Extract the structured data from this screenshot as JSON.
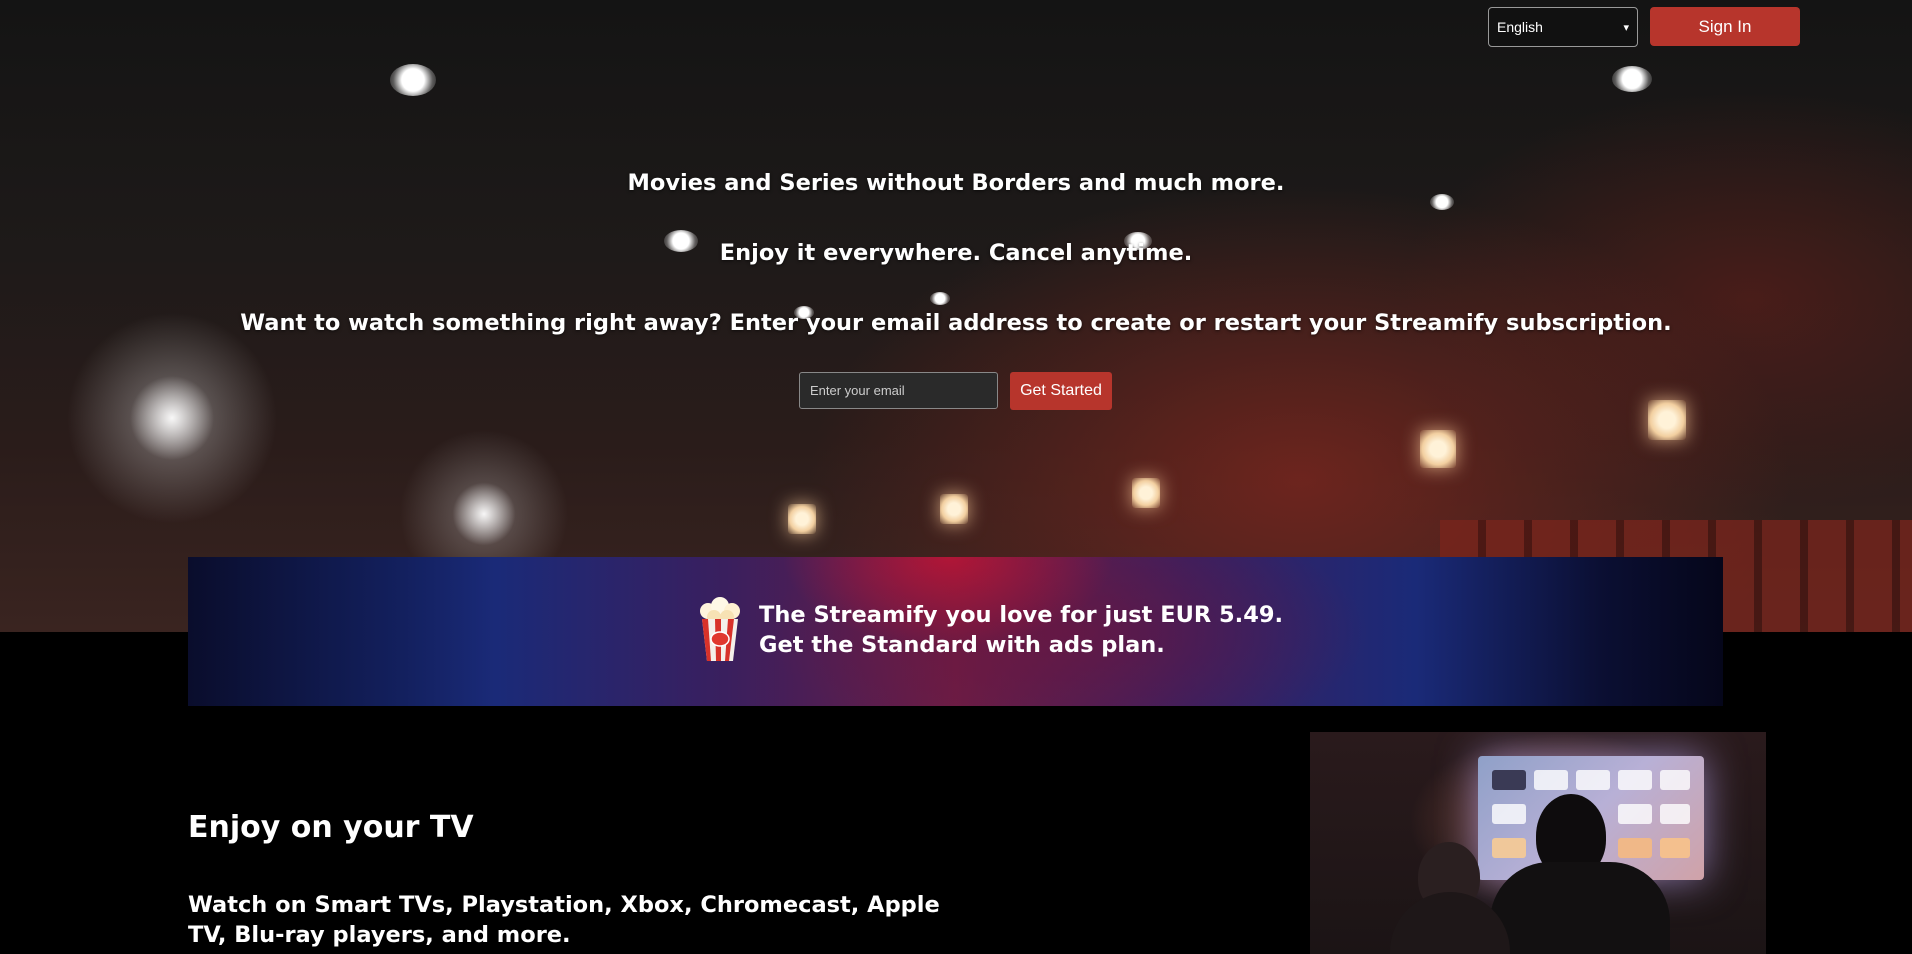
{
  "header": {
    "language_selected": "English",
    "signin_label": "Sign In"
  },
  "hero": {
    "line1": "Movies and Series without Borders and much more.",
    "line2": "Enjoy it everywhere. Cancel anytime.",
    "line3": "Want to watch something right away? Enter your email address to create or restart your Streamify subscription.",
    "email_placeholder": "Enter your email",
    "cta_label": "Get Started"
  },
  "promo": {
    "line1": "The Streamify you love for just EUR 5.49.",
    "line2": "Get the Standard with ads plan.",
    "icon": "popcorn-icon"
  },
  "tv_section": {
    "title": "Enjoy on your TV",
    "description": "Watch on Smart TVs, Playstation, Xbox, Chromecast, Apple TV, Blu-ray players, and more."
  },
  "colors": {
    "accent": "#b7352c",
    "background": "#000000"
  }
}
